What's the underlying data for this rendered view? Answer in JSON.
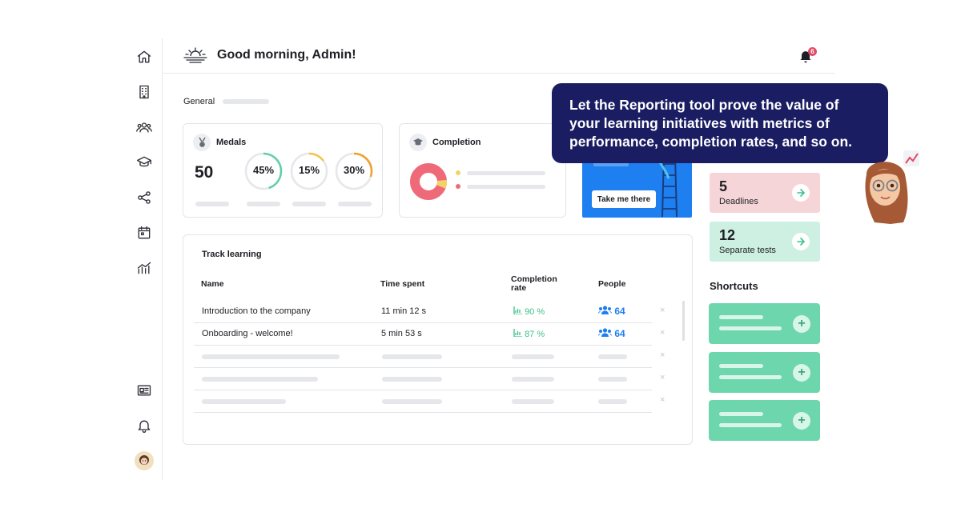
{
  "header": {
    "greeting": "Good morning, Admin!",
    "notification_count": "6"
  },
  "sidebar": {
    "items": [
      {
        "icon": "home-icon"
      },
      {
        "icon": "building-icon"
      },
      {
        "icon": "users-icon"
      },
      {
        "icon": "graduation-cap-icon"
      },
      {
        "icon": "share-icon"
      },
      {
        "icon": "calendar-icon"
      },
      {
        "icon": "reports-chart-icon"
      },
      {
        "icon": "news-icon"
      },
      {
        "icon": "bell-icon"
      }
    ]
  },
  "main": {
    "section_label": "General",
    "medals": {
      "title": "Medals",
      "count": "50",
      "rings": [
        {
          "label": "45%",
          "value": 0.45,
          "color": "#5fd0a8"
        },
        {
          "label": "15%",
          "value": 0.15,
          "color": "#f2c54a"
        },
        {
          "label": "30%",
          "value": 0.3,
          "color": "#f0a02b"
        }
      ]
    },
    "completion": {
      "title": "Completion",
      "donut_colors": [
        "#ef6a78",
        "#f2d36a"
      ]
    },
    "promo": {
      "button_label": "Take me there",
      "color": "#1e7ff0"
    },
    "tooltip": {
      "text": "Let the Reporting tool prove the value of your learning initiatives with metrics of performance, completion rates, and so on."
    }
  },
  "right": {
    "stats": [
      {
        "number": "5",
        "label": "Deadlines",
        "color": "#f6d5d9"
      },
      {
        "number": "12",
        "label": "Separate tests",
        "color": "#cdf0e2"
      }
    ],
    "shortcuts_title": "Shortcuts"
  },
  "table": {
    "title": "Track learning",
    "columns": {
      "name": "Name",
      "time": "Time spent",
      "rate": "Completion rate",
      "people": "People"
    },
    "rows": [
      {
        "name": "Introduction to the company",
        "time": "11 min 12 s",
        "rate": "90 %",
        "people": "64"
      },
      {
        "name": "Onboarding - welcome!",
        "time": "5 min 53 s",
        "rate": "87 %",
        "people": "64"
      }
    ],
    "remove_symbol": "×"
  }
}
